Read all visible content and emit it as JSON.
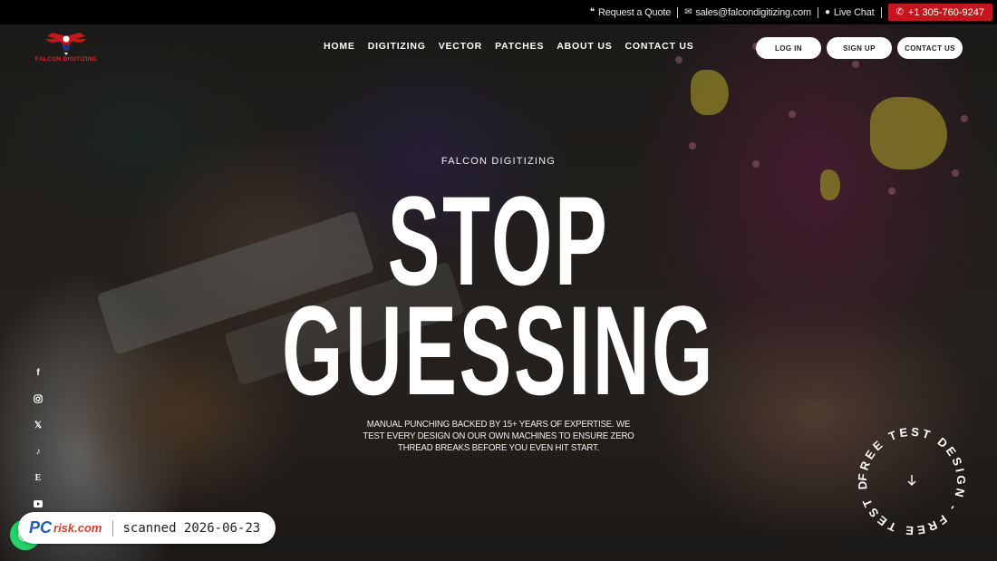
{
  "topbar": {
    "quote_label": "Request a Quote",
    "email": "sales@falcondigitizing.com",
    "chat_label": "Live Chat",
    "phone": "+1 305-760-9247"
  },
  "brand": {
    "logo_text": "FALCON DIGITIZING",
    "accent_color": "#c4161c"
  },
  "nav": {
    "items": [
      "HOME",
      "DIGITIZING",
      "VECTOR",
      "PATCHES",
      "ABOUT US",
      "CONTACT US"
    ]
  },
  "auth": {
    "login": "LOG IN",
    "signup": "SIGN UP",
    "contact": "CONTACT US"
  },
  "hero": {
    "eyebrow": "FALCON DIGITIZING",
    "headline_1": "STOP",
    "headline_2": "GUESSING",
    "subtext": "MANUAL PUNCHING BACKED BY 15+ YEARS OF EXPERTISE. WE TEST EVERY DESIGN ON OUR OWN MACHINES TO ENSURE ZERO THREAD BREAKS BEFORE YOU EVEN HIT START."
  },
  "badge": {
    "ring_text": "FREE TEST DESIGN - FREE TEST DESIGN - ",
    "icon": "arrow-down-icon"
  },
  "social": {
    "icons": [
      "facebook-icon",
      "instagram-icon",
      "x-icon",
      "tiktok-icon",
      "etsy-icon",
      "youtube-icon"
    ]
  },
  "watermark": {
    "brand_pc": "PC",
    "brand_risk": "risk.com",
    "scan_text": "scanned 2026-06-23"
  }
}
